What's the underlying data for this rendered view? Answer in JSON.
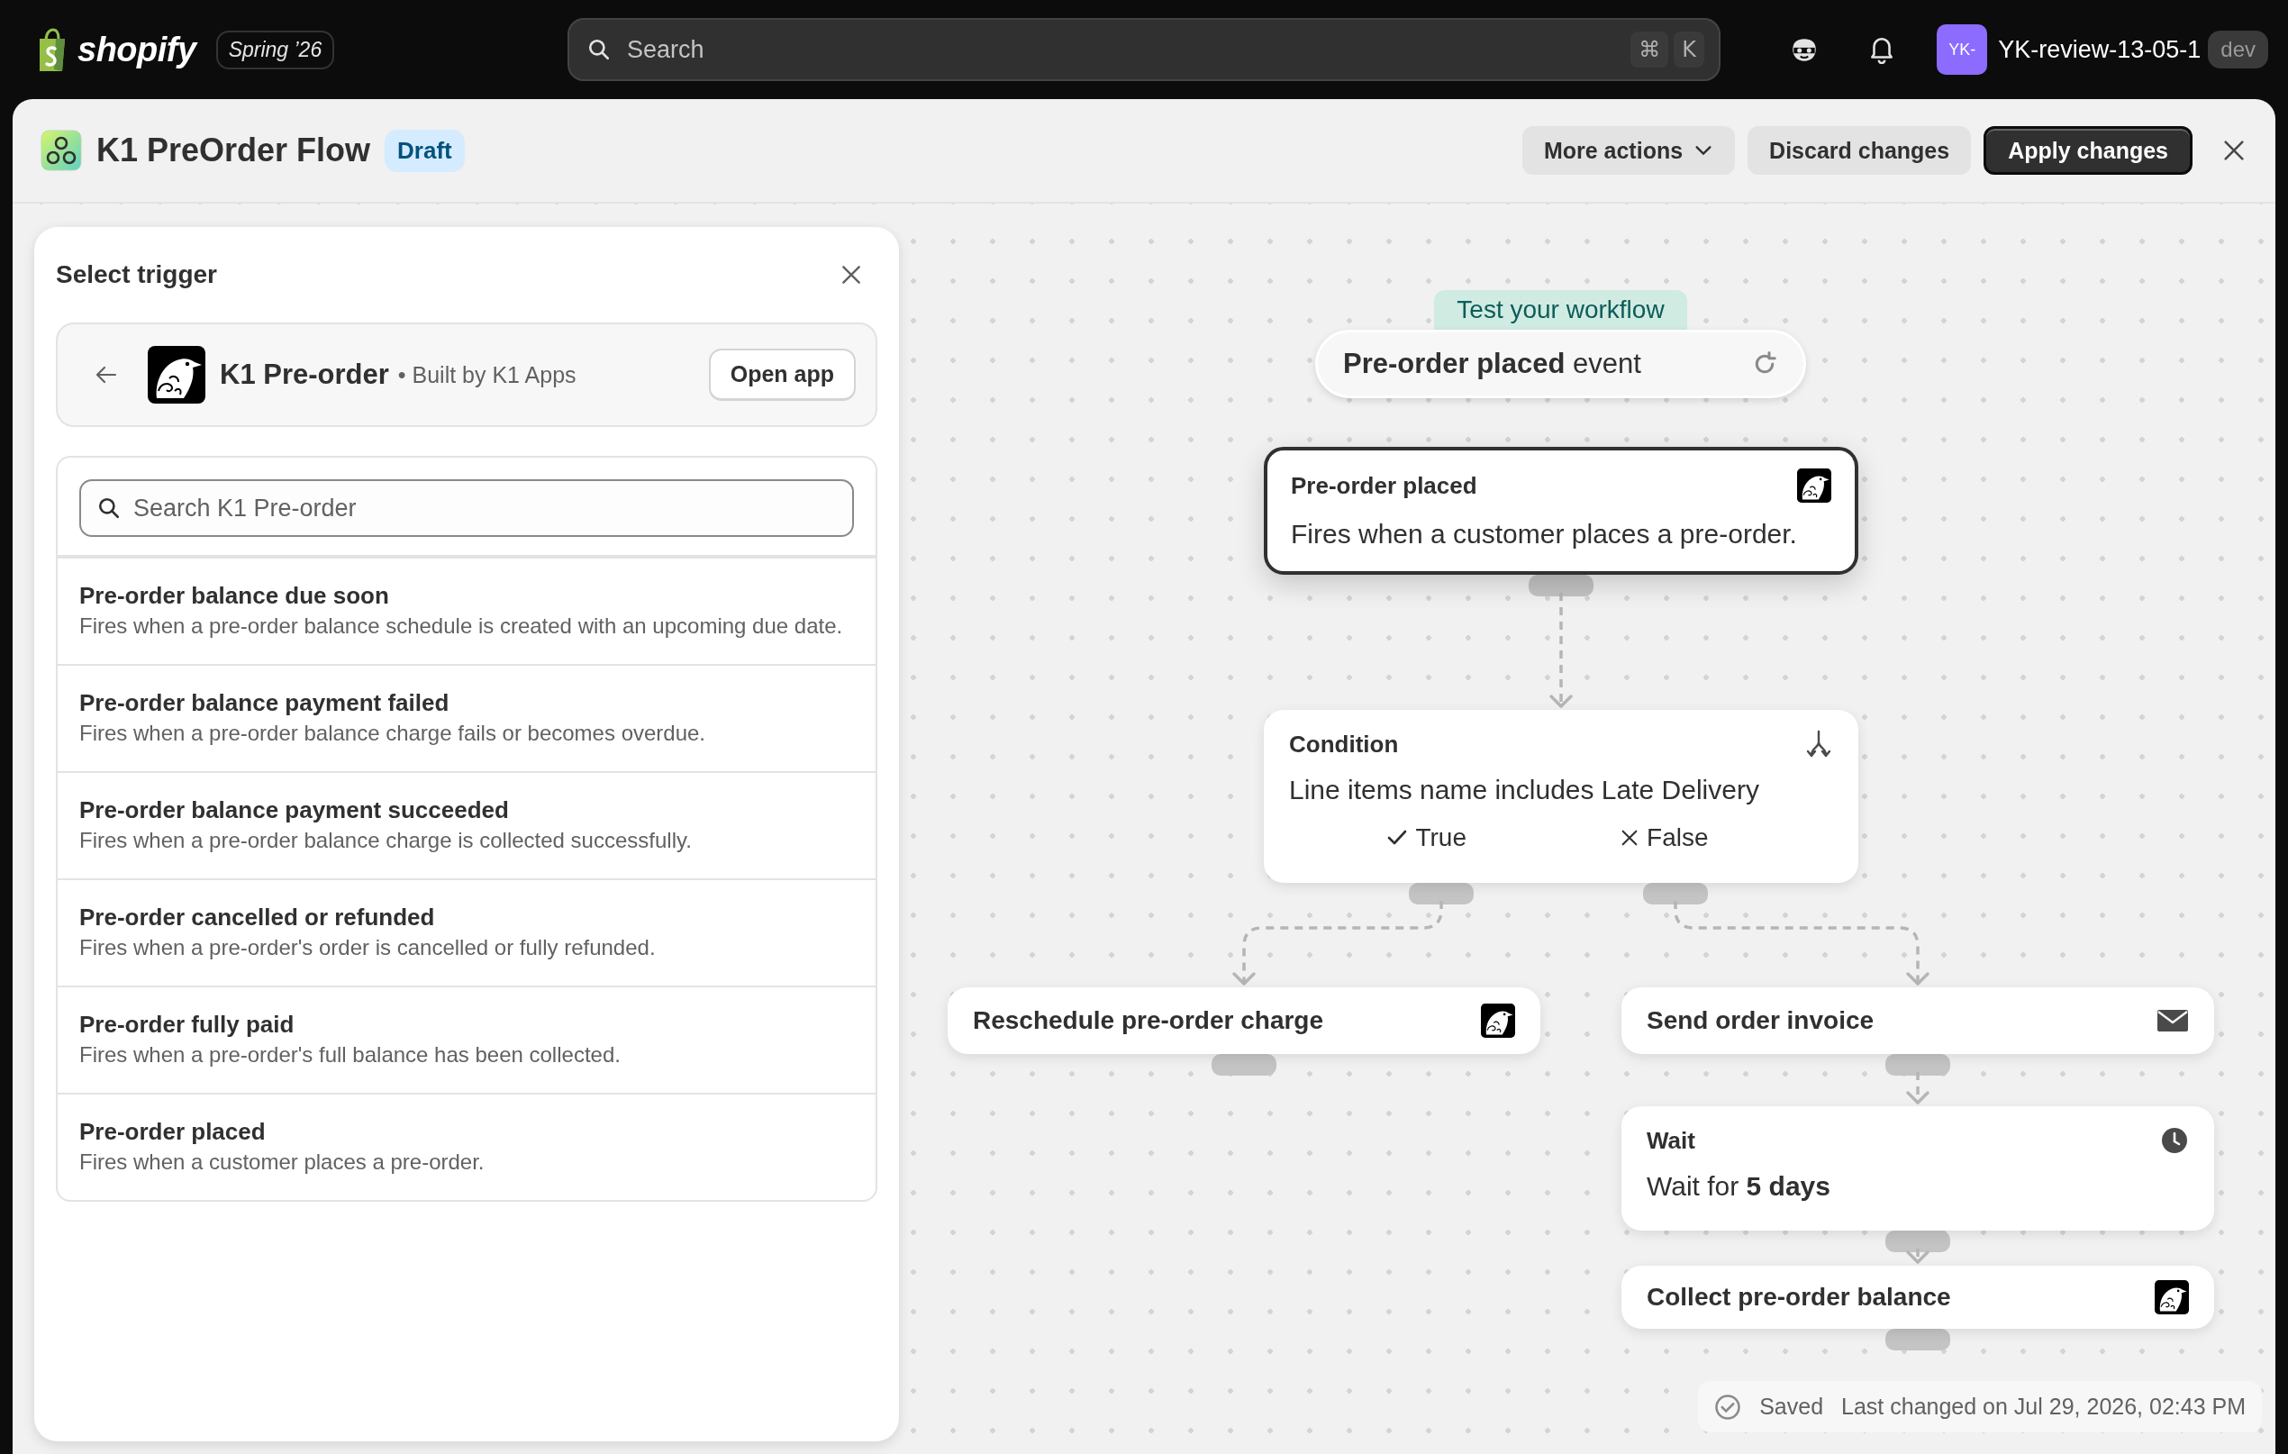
{
  "topbar": {
    "logo_text": "shopify",
    "edition": "Spring ’26",
    "search": {
      "placeholder": "Search",
      "shortcut_keys": [
        "⌘",
        "K"
      ]
    },
    "account": {
      "initials": "YK-",
      "name": "YK-review-13-05-1",
      "badge": "dev"
    }
  },
  "header": {
    "title": "K1 PreOrder Flow",
    "status": "Draft",
    "buttons": [
      {
        "label": "More actions",
        "kind": "menu"
      },
      {
        "label": "Discard changes",
        "kind": "secondary"
      },
      {
        "label": "Apply changes",
        "kind": "primary"
      }
    ]
  },
  "trigger_panel": {
    "title": "Select trigger",
    "app": {
      "name": "K1 Pre-order",
      "byline": "• Built by K1 Apps",
      "button": "Open app"
    },
    "search": {
      "placeholder": "Search K1 Pre-order"
    },
    "triggers": [
      {
        "title": "Pre-order balance due soon",
        "description": "Fires when a pre-order balance schedule is created with an upcoming due date."
      },
      {
        "title": "Pre-order balance payment failed",
        "description": "Fires when a pre-order balance charge fails or becomes overdue."
      },
      {
        "title": "Pre-order balance payment succeeded",
        "description": "Fires when a pre-order balance charge is collected successfully."
      },
      {
        "title": "Pre-order cancelled or refunded",
        "description": "Fires when a pre-order's order is cancelled or fully refunded."
      },
      {
        "title": "Pre-order fully paid",
        "description": "Fires when a pre-order's full balance has been collected."
      },
      {
        "title": "Pre-order placed",
        "description": "Fires when a customer places a pre-order."
      }
    ]
  },
  "canvas": {
    "test_label": "Test your workflow",
    "test_event": "**Pre-order placed** event",
    "nodes": [
      {
        "kind": "trigger",
        "title": "Pre-order placed",
        "description": "Fires when a customer places a pre-order.",
        "selected": true
      },
      {
        "kind": "condition",
        "title": "Condition",
        "description": "Line items name includes Late Delivery",
        "selected": false,
        "branches": [
          {
            "kind": "true",
            "label": "True"
          },
          {
            "kind": "false",
            "label": "False"
          }
        ]
      },
      {
        "kind": "app_action",
        "title": "Reschedule pre-order charge",
        "selected": false
      },
      {
        "kind": "email_action",
        "title": "Send order invoice",
        "selected": false
      },
      {
        "kind": "wait",
        "title": "Wait",
        "description": "Wait for **5 days**",
        "selected": false
      },
      {
        "kind": "app_action",
        "title": "Collect pre-order balance",
        "selected": false
      }
    ]
  },
  "status_bar": {
    "state": "Saved",
    "last_changed": "Last changed on Jul 29, 2026, 02:43 PM"
  }
}
